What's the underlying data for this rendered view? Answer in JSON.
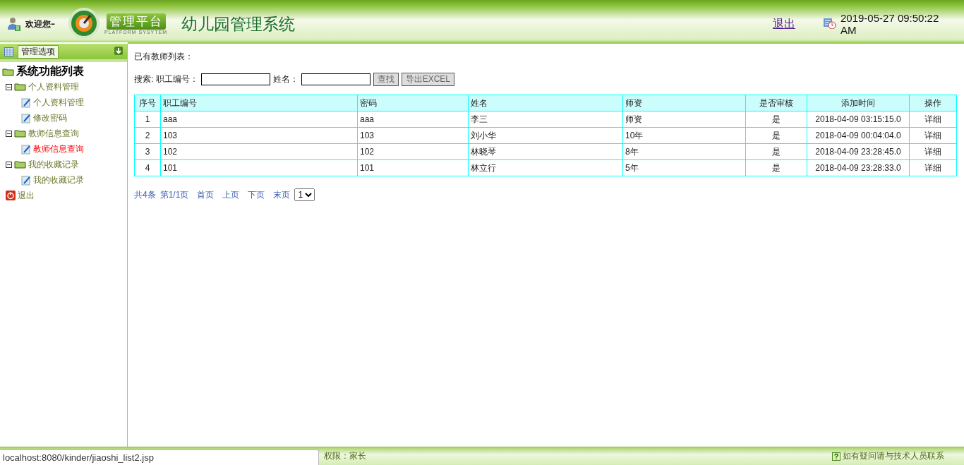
{
  "header": {
    "welcome": "欢迎您–",
    "badge": "管理平台",
    "badge_sub": "PLATFORM SYSYTEM",
    "title": "幼儿园管理系统",
    "logout": "退出",
    "datetime": "2019-05-27 09:50:22 AM"
  },
  "sidebar": {
    "heading": "管理选项",
    "tree": {
      "label": "系统功能列表",
      "children": [
        {
          "kind": "folder",
          "label": "个人资料管理",
          "selected": false,
          "children": [
            {
              "kind": "page",
              "label": "个人资料管理",
              "selected": false
            },
            {
              "kind": "page",
              "label": "修改密码",
              "selected": false
            }
          ]
        },
        {
          "kind": "folder",
          "label": "教师信息查询",
          "selected": false,
          "children": [
            {
              "kind": "page",
              "label": "教师信息查询",
              "selected": true
            }
          ]
        },
        {
          "kind": "folder",
          "label": "我的收藏记录",
          "selected": false,
          "children": [
            {
              "kind": "page",
              "label": "我的收藏记录",
              "selected": false
            }
          ]
        },
        {
          "kind": "exit",
          "label": "退出",
          "selected": false
        }
      ]
    }
  },
  "main": {
    "caption": "已有教师列表：",
    "search": {
      "label": "搜索: 职工编号：",
      "field_2_label": "姓名：",
      "buttons": [
        "查找",
        "导出EXCEL"
      ]
    },
    "table": {
      "columns": [
        "序号",
        "职工编号",
        "密码",
        "姓名",
        "师资",
        "是否审核",
        "添加时间",
        "操作"
      ],
      "rows": [
        [
          "1",
          "aaa",
          "aaa",
          "李三",
          "师资",
          "是",
          "2018-04-09 03:15:15.0",
          "详细"
        ],
        [
          "2",
          "103",
          "103",
          "刘小华",
          "10年",
          "是",
          "2018-04-09 00:04:04.0",
          "详细"
        ],
        [
          "3",
          "102",
          "102",
          "林晓琴",
          "8年",
          "是",
          "2018-04-09 23:28:45.0",
          "详细"
        ],
        [
          "4",
          "101",
          "101",
          "林立行",
          "5年",
          "是",
          "2018-04-09 23:28:33.0",
          "详细"
        ]
      ]
    },
    "pager": {
      "total": "共4条",
      "page": "第1/1页",
      "links": [
        "首页",
        "上页",
        "下页",
        "末页"
      ],
      "page_select": "1"
    }
  },
  "footer": {
    "role_label": "权限：",
    "role": "家长",
    "help": "如有疑问请与技术人员联系"
  },
  "status_url": "localhost:8080/kinder/jiaoshi_list2.jsp"
}
